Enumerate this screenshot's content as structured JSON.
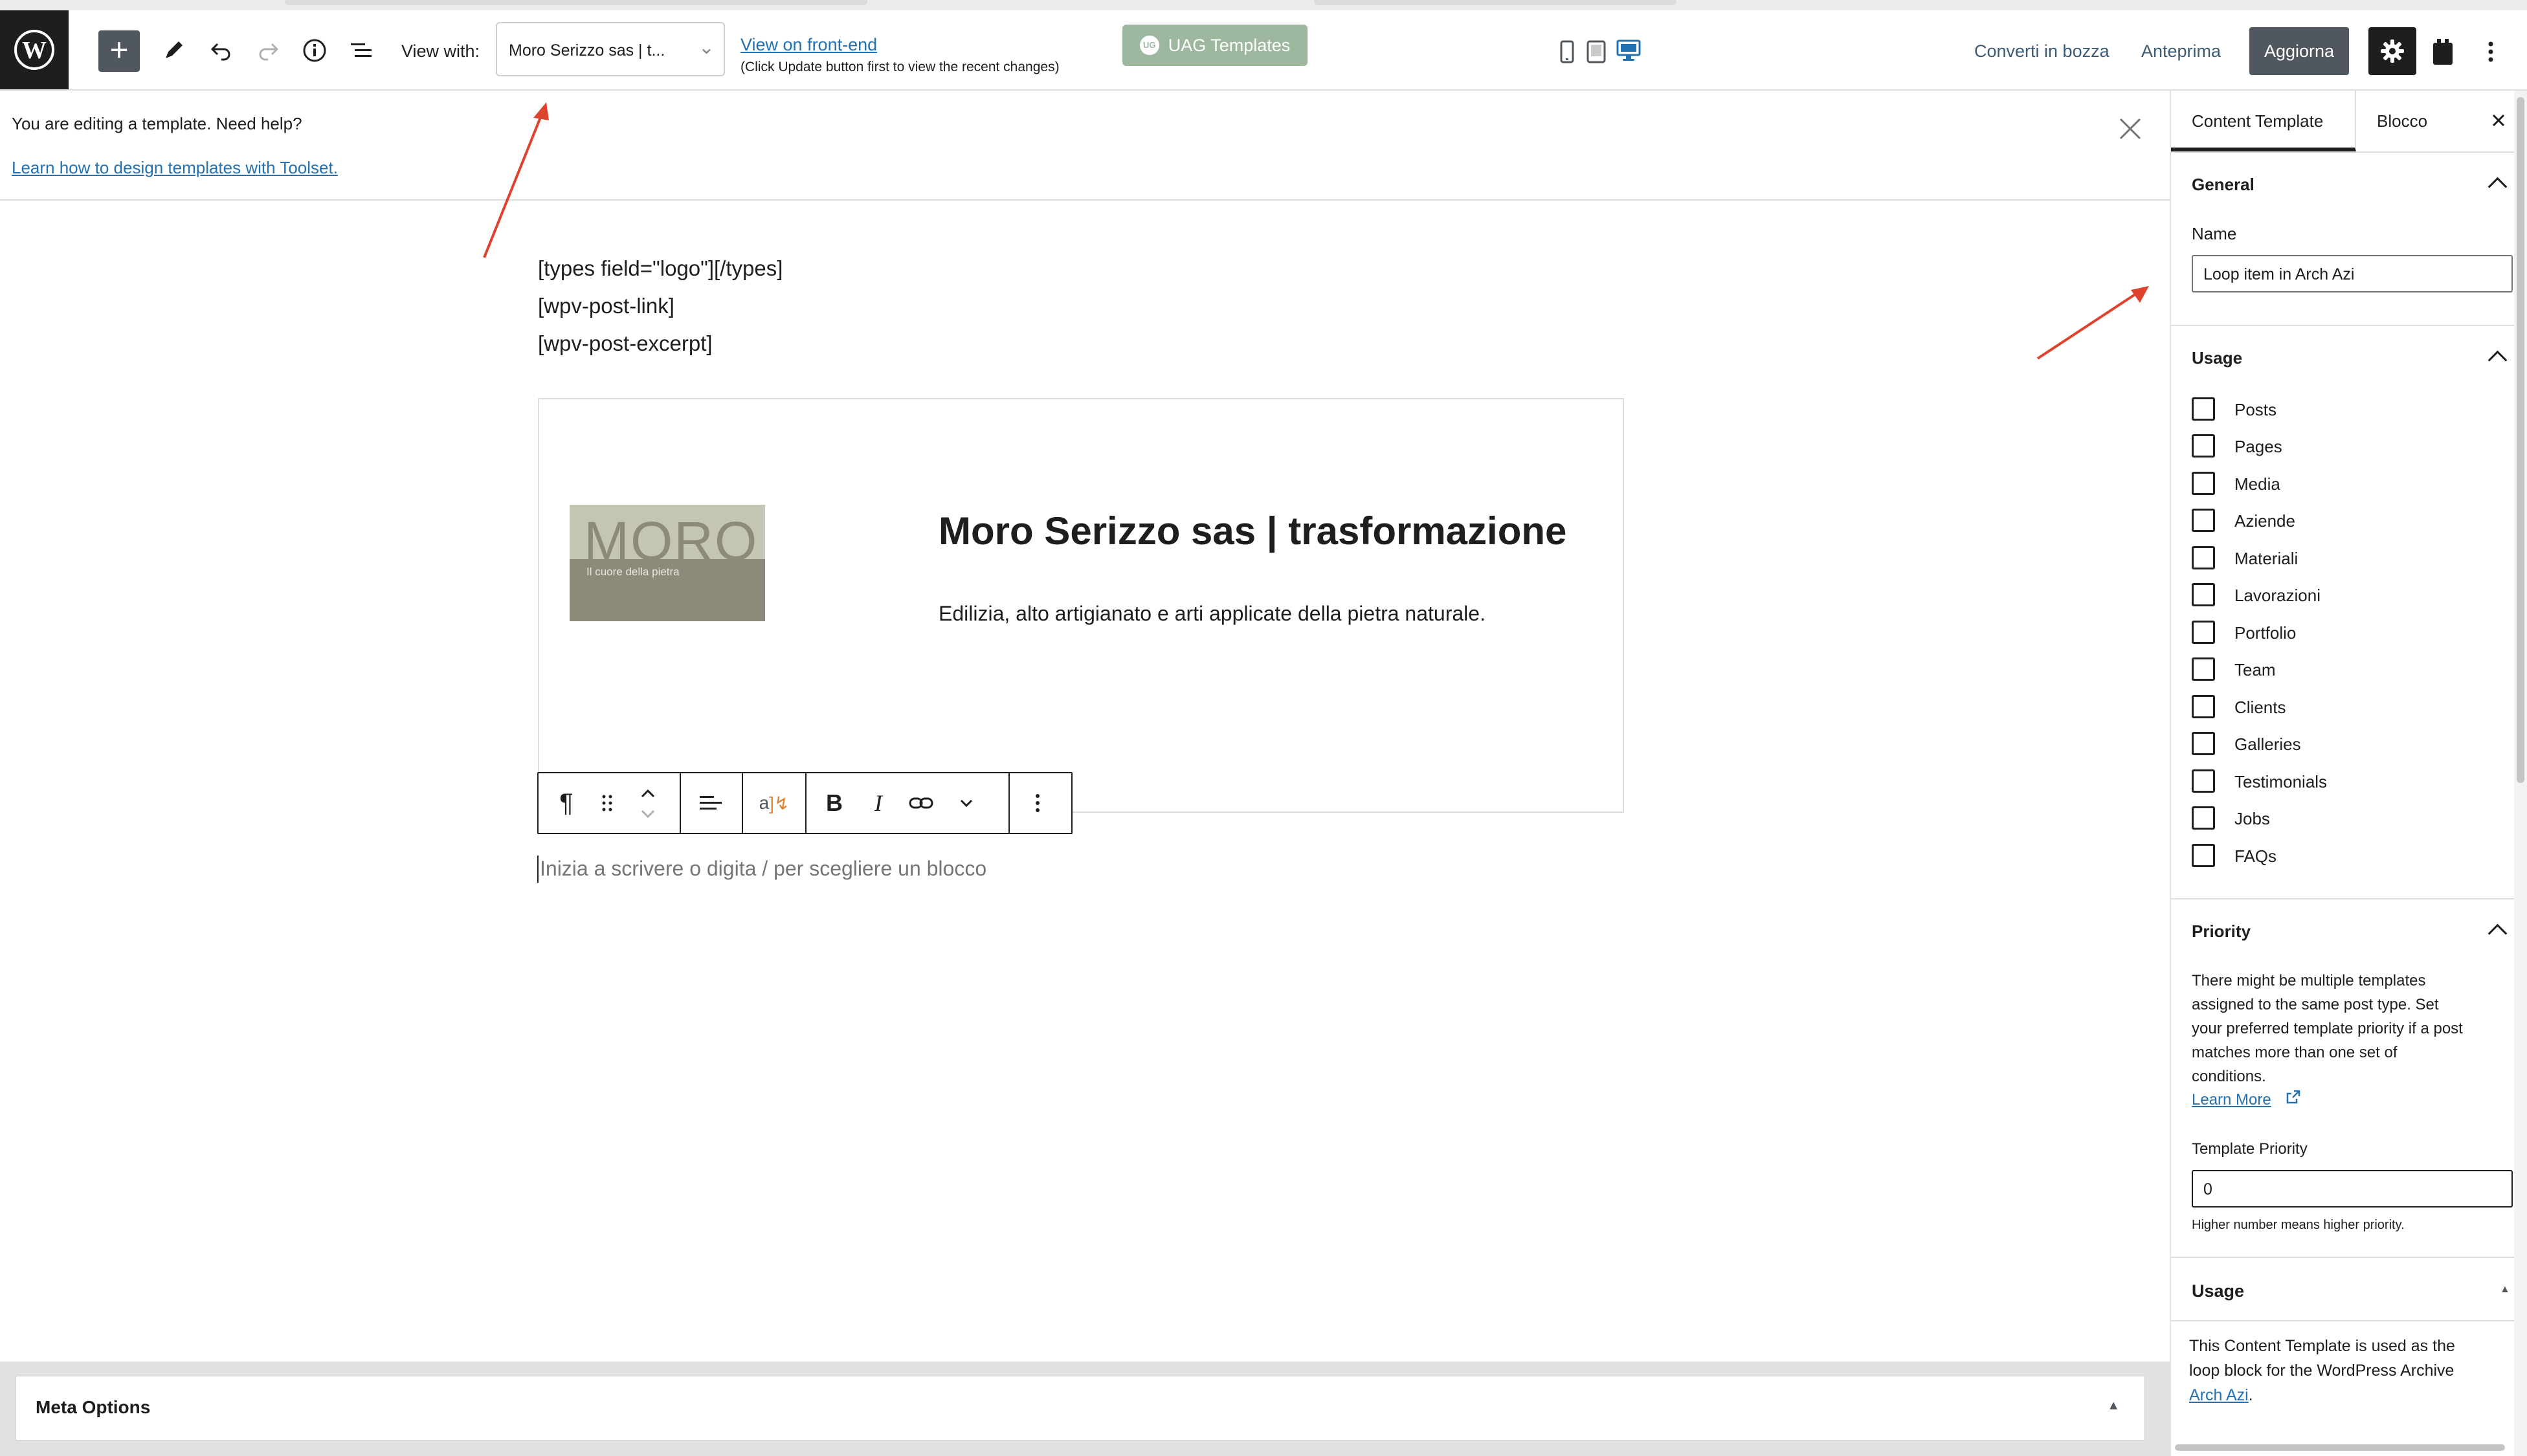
{
  "toolbar": {
    "view_with_label": "View with:",
    "view_select_value": "Moro Serizzo sas | t...",
    "view_frontend_link": "View on front-end",
    "view_frontend_hint": "(Click Update button first to view the recent changes)",
    "uag_button": "UAG Templates",
    "uag_badge": "UG",
    "save_draft": "Converti in bozza",
    "preview": "Anteprima",
    "update": "Aggiorna"
  },
  "notice": {
    "text": "You are editing a template. Need help?",
    "link": "Learn how to design templates with Toolset."
  },
  "editor": {
    "code_lines": [
      "[types field=\"logo\"][/types]",
      "[wpv-post-link]",
      "[wpv-post-excerpt]"
    ],
    "preview_title": "Moro Serizzo sas | trasformazione",
    "preview_excerpt": "Edilizia, alto artigianato e arti applicate della pietra naturale.",
    "logo_text": "MORO",
    "logo_tagline": "Il cuore della pietra",
    "placeholder": "Inizia a scrivere o digita / per scegliere un blocco"
  },
  "meta": {
    "title": "Meta Options"
  },
  "sidebar": {
    "tabs": [
      "Content Template",
      "Blocco"
    ],
    "general": {
      "title": "General",
      "name_label": "Name",
      "name_value": "Loop item in Arch Azi"
    },
    "usage": {
      "title": "Usage",
      "items": [
        "Posts",
        "Pages",
        "Media",
        "Aziende",
        "Materiali",
        "Lavorazioni",
        "Portfolio",
        "Team",
        "Clients",
        "Galleries",
        "Testimonials",
        "Jobs",
        "FAQs"
      ]
    },
    "priority": {
      "title": "Priority",
      "lines": [
        "There might be multiple templates",
        "assigned to the same post type. Set",
        "your preferred template priority if a post",
        "matches more than one set of",
        "conditions."
      ],
      "learn_more": "Learn More",
      "field_label": "Template Priority",
      "field_value": "0",
      "hint": "Higher number means higher priority."
    },
    "usage2": {
      "title": "Usage",
      "lines": [
        "This Content Template is used as the",
        "loop block for the WordPress Archive"
      ],
      "link": "Arch Azi",
      "period": "."
    }
  },
  "colors": {
    "annotation_arrow": "#e0432d",
    "accent": "#2271b1",
    "dark": "#1e1e1e",
    "uag": "#9db89f",
    "logo_top": "#c5c5b3",
    "logo_bottom": "#8c8b79"
  }
}
